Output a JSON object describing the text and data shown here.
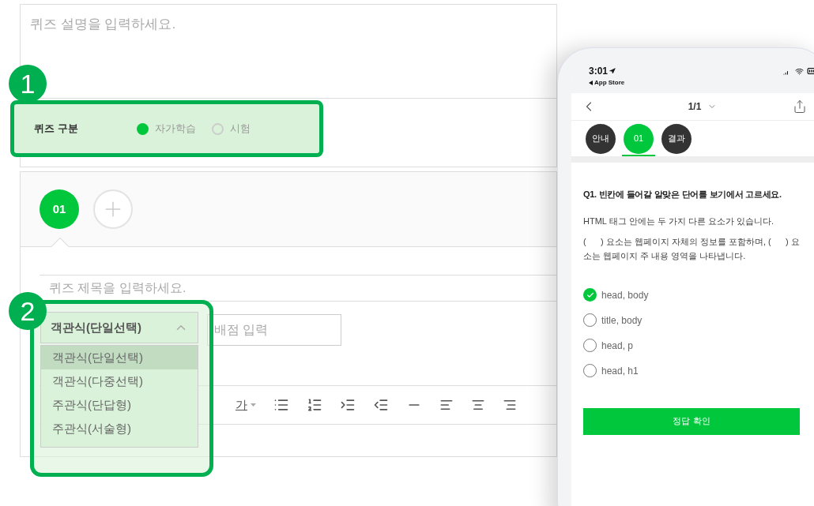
{
  "editor": {
    "description_placeholder": "퀴즈 설명을 입력하세요.",
    "quiz_type": {
      "label": "퀴즈 구분",
      "options": [
        {
          "label": "자가학습",
          "selected": true
        },
        {
          "label": "시험",
          "selected": false
        }
      ]
    },
    "question_tabs": [
      {
        "label": "01",
        "selected": true
      }
    ],
    "title_placeholder": "퀴즈 제목을 입력하세요.",
    "type_select": {
      "value": "객관식(단일선택)",
      "expanded": true,
      "options": [
        {
          "label": "객관식(단일선택)",
          "selected": true
        },
        {
          "label": "객관식(다중선택)",
          "selected": false
        },
        {
          "label": "주관식(단답형)",
          "selected": false
        },
        {
          "label": "주관식(서술형)",
          "selected": false
        }
      ]
    },
    "score_placeholder": "배점 입력",
    "toolbar": {
      "text_color_label": "가"
    }
  },
  "callouts": [
    {
      "number": "1"
    },
    {
      "number": "2"
    }
  ],
  "phone": {
    "time": "3:01",
    "back_label": "App Store",
    "page_indicator": "1/1",
    "tabs": [
      {
        "label": "안내",
        "selected": false
      },
      {
        "label": "01",
        "selected": true
      },
      {
        "label": "결과",
        "selected": false
      }
    ],
    "question": "Q1. 빈칸에 들어갈 알맞은 단어를 보기에서 고르세요.",
    "paragraphs": [
      "HTML 태그 안에는 두 가지 다른 요소가 있습니다.",
      "(      ) 요소는 웹페이지 자체의 정보를 포함하며, (      ) 요소는 웹페이지 주 내용 영역을 나타냅니다."
    ],
    "choices": [
      {
        "label": "head, body",
        "selected": true
      },
      {
        "label": "title, body",
        "selected": false
      },
      {
        "label": "head, p",
        "selected": false
      },
      {
        "label": "head, h1",
        "selected": false
      }
    ],
    "submit": "정답 확인"
  }
}
